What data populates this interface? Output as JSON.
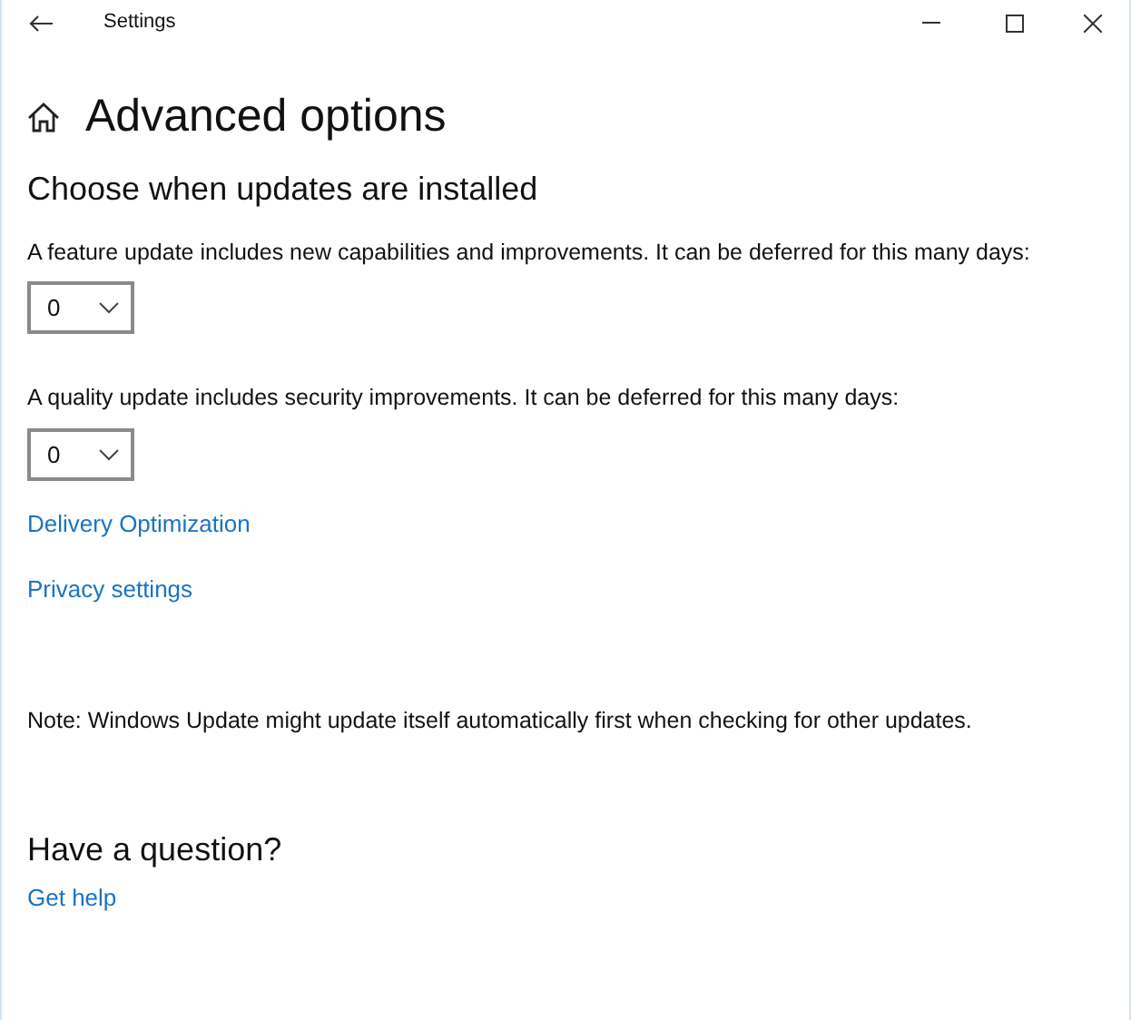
{
  "window": {
    "title": "Settings"
  },
  "page": {
    "title": "Advanced options"
  },
  "section": {
    "title": "Choose when updates are installed"
  },
  "deferrals": [
    {
      "label": "A feature update includes new capabilities and improvements. It can be deferred for this many days:",
      "value": "0"
    },
    {
      "label": "A quality update includes security improvements. It can be deferred for this many days:",
      "value": "0"
    }
  ],
  "links": [
    "Delivery Optimization",
    "Privacy settings"
  ],
  "note": "Note: Windows Update might update itself automatically first when checking for other updates.",
  "help": {
    "title": "Have a question?",
    "link": "Get help"
  }
}
